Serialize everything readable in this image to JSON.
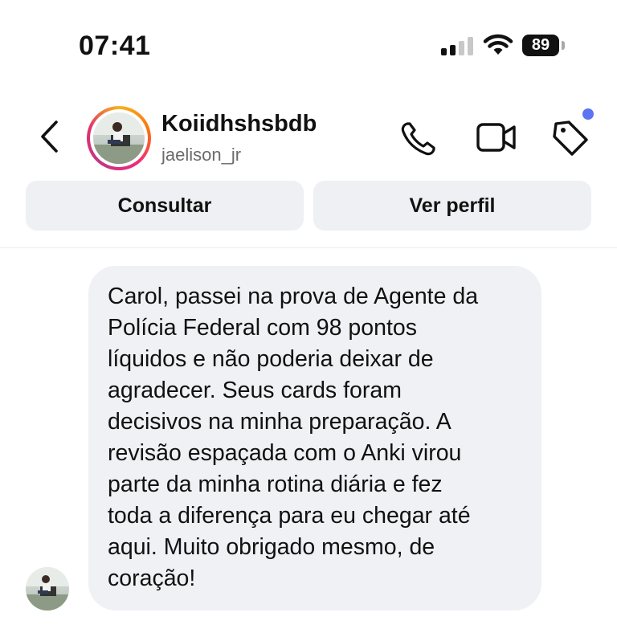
{
  "status_bar": {
    "time": "07:41",
    "battery": "89",
    "signal_bars_active": 2,
    "signal_bars_total": 4
  },
  "header": {
    "title": "Koiidhshsbdb",
    "username": "jaelison_jr",
    "icons": [
      "back-chevron-icon",
      "phone-call-icon",
      "video-call-icon",
      "tag-icon"
    ],
    "notification_dot_color": "#5c73f2"
  },
  "actions": {
    "consult_label": "Consultar",
    "profile_label": "Ver perfil"
  },
  "messages": [
    {
      "text": "Carol, passei na prova de Agente da\nPolícia Federal com 98 pontos\nlíquidos e não poderia deixar de\nagradecer. Seus cards foram\ndecisivos na minha preparação. A\nrevisão espaçada com o Anki virou\nparte da minha rotina diária e fez\ntoda a diferença para eu chegar até\naqui. Muito obrigado mesmo, de\ncoração!"
    }
  ],
  "colors": {
    "bubble": "#eff1f4",
    "button": "#eef0f3",
    "username": "#6b6b6b"
  }
}
